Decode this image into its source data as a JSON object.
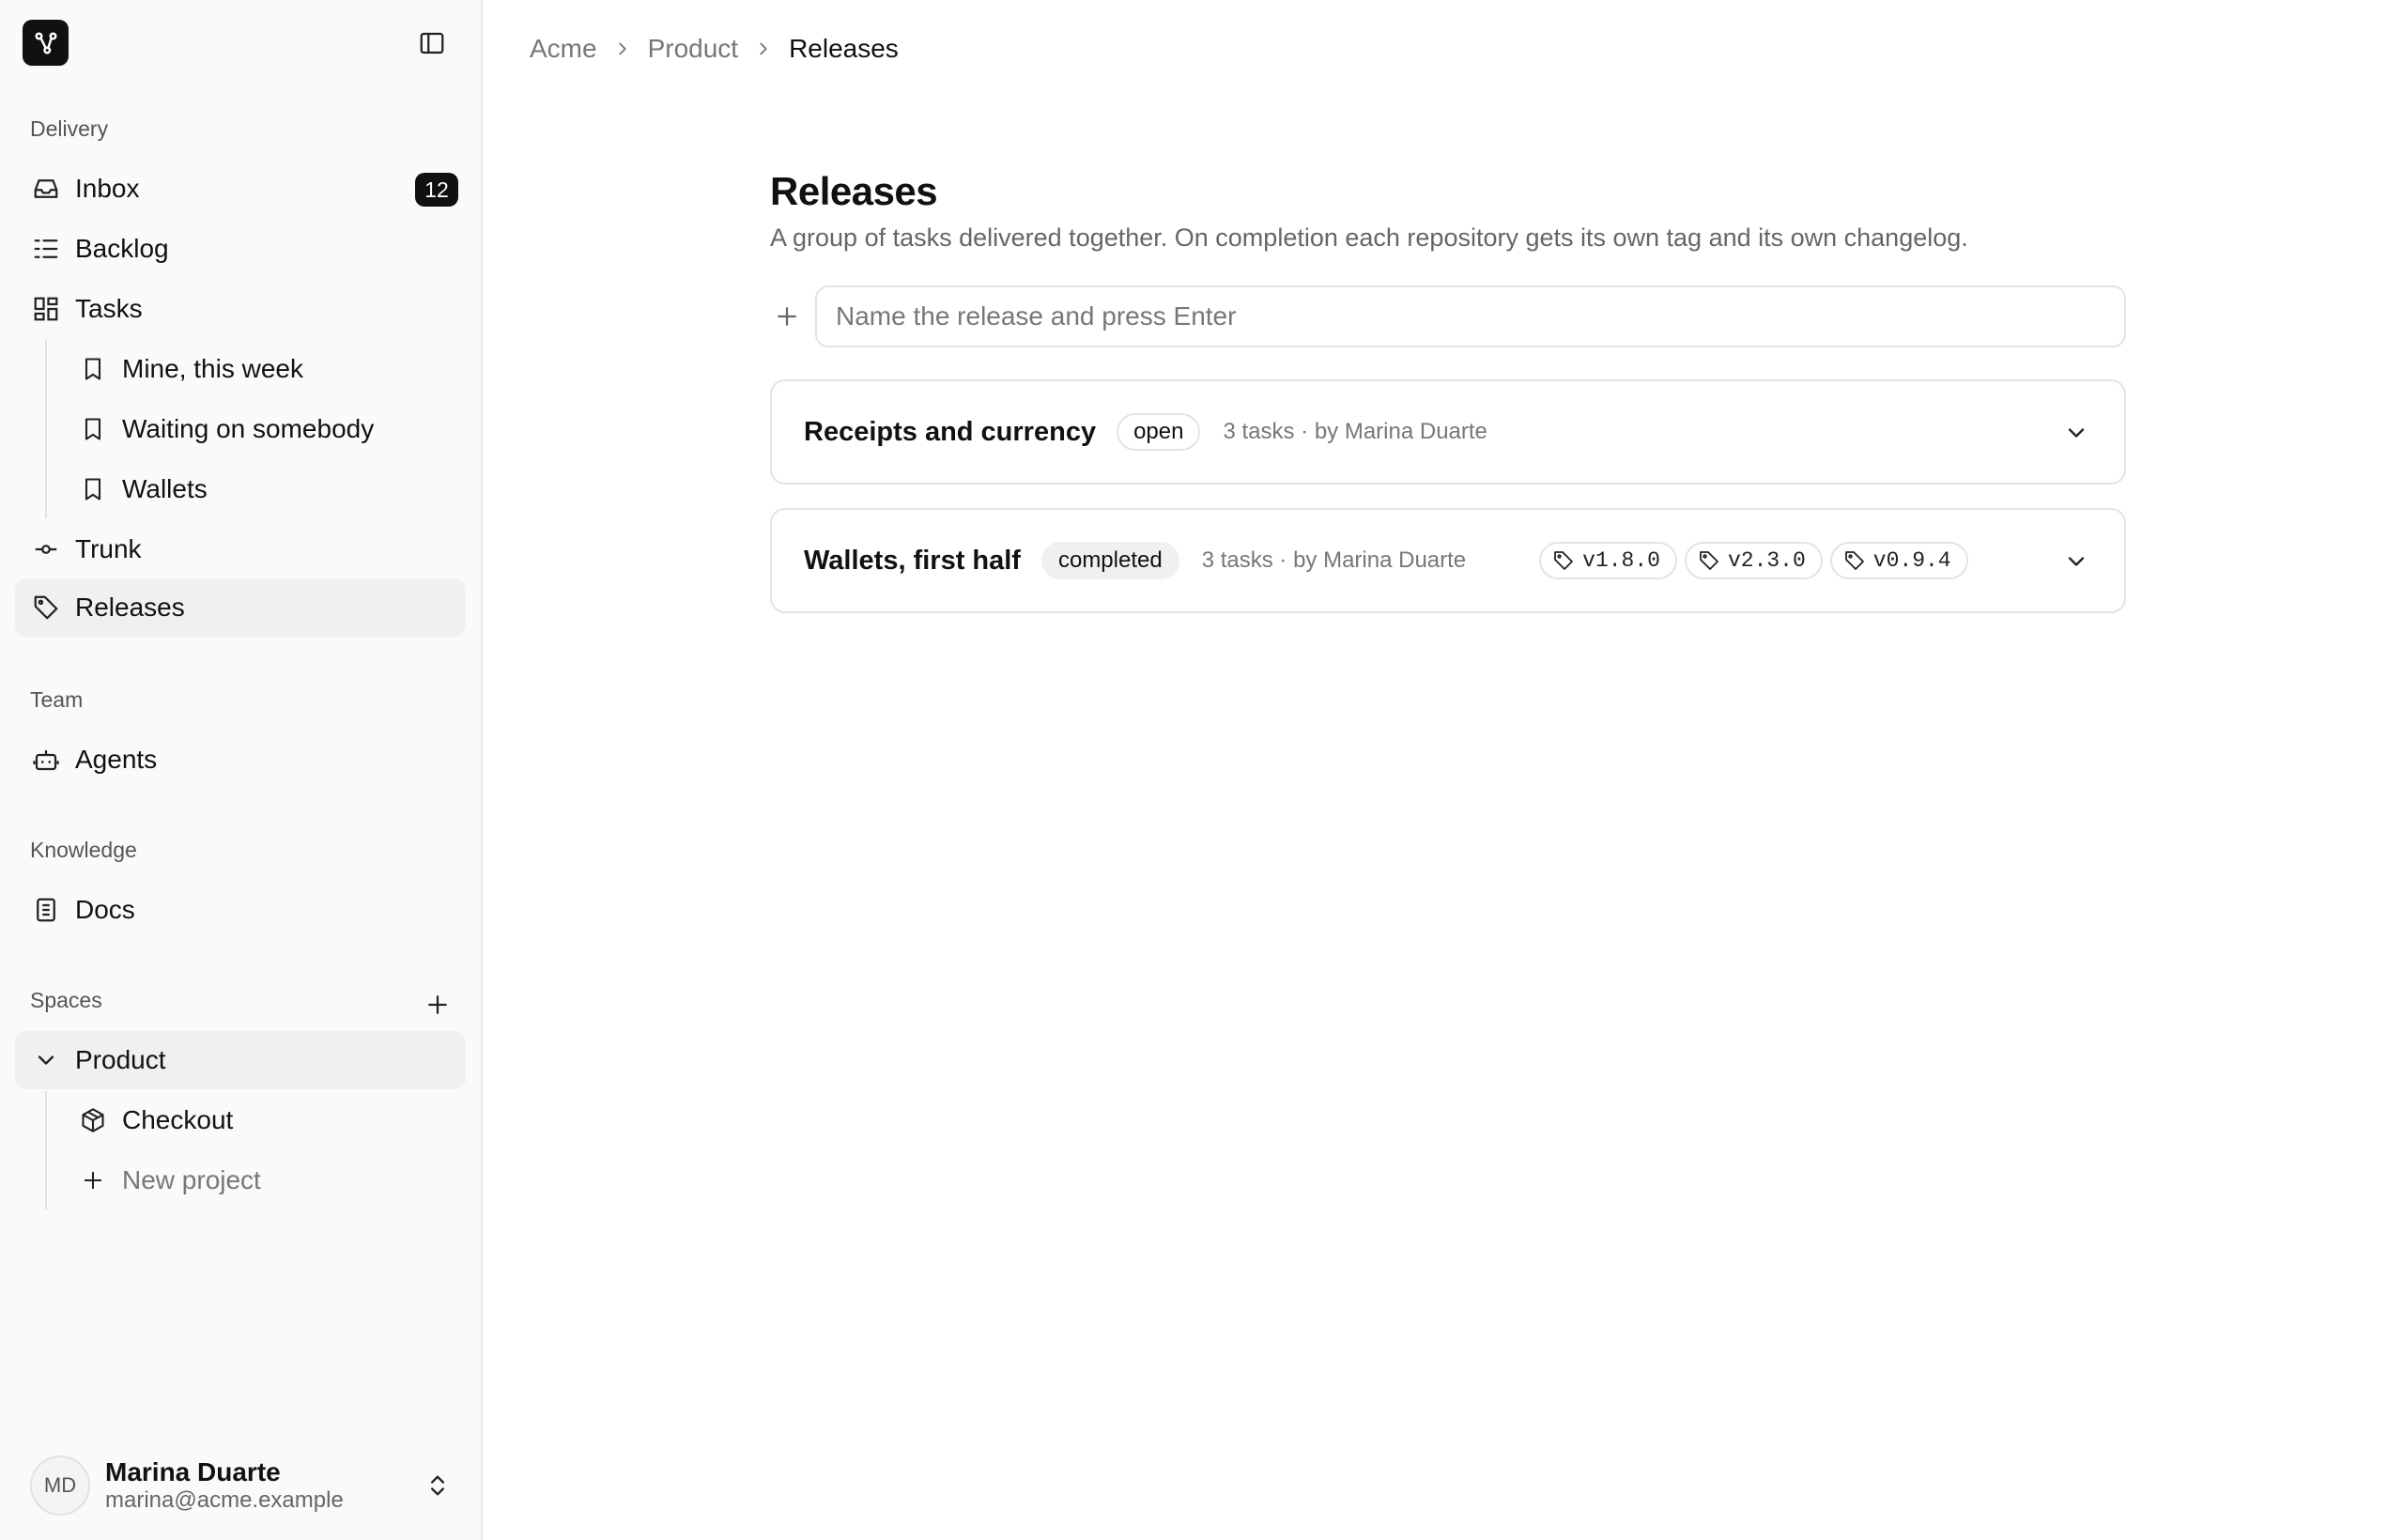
{
  "sidebar": {
    "sections": {
      "delivery": "Delivery",
      "team": "Team",
      "knowledge": "Knowledge",
      "spaces": "Spaces"
    },
    "inbox": {
      "label": "Inbox",
      "count": "12"
    },
    "backlog": {
      "label": "Backlog"
    },
    "tasks": {
      "label": "Tasks"
    },
    "views": [
      {
        "label": "Mine, this week"
      },
      {
        "label": "Waiting on somebody"
      },
      {
        "label": "Wallets"
      }
    ],
    "trunk": {
      "label": "Trunk"
    },
    "releases": {
      "label": "Releases"
    },
    "agents": {
      "label": "Agents"
    },
    "docs": {
      "label": "Docs"
    },
    "space": {
      "label": "Product"
    },
    "projects": [
      {
        "label": "Checkout"
      }
    ],
    "new_project": {
      "label": "New project"
    },
    "user": {
      "initials": "MD",
      "name": "Marina Duarte",
      "email": "marina@acme.example"
    }
  },
  "breadcrumb": [
    "Acme",
    "Product",
    "Releases"
  ],
  "page": {
    "title": "Releases",
    "subtitle": "A group of tasks delivered together. On completion each repository gets its own tag and its own changelog.",
    "new_release_placeholder": "Name the release and press Enter"
  },
  "releases": [
    {
      "name": "Receipts and currency",
      "status": "open",
      "meta": "3 tasks · by Marina Duarte",
      "tags": []
    },
    {
      "name": "Wallets, first half",
      "status": "completed",
      "meta": "3 tasks · by Marina Duarte",
      "tags": [
        "v1.8.0",
        "v2.3.0",
        "v0.9.4"
      ]
    }
  ]
}
